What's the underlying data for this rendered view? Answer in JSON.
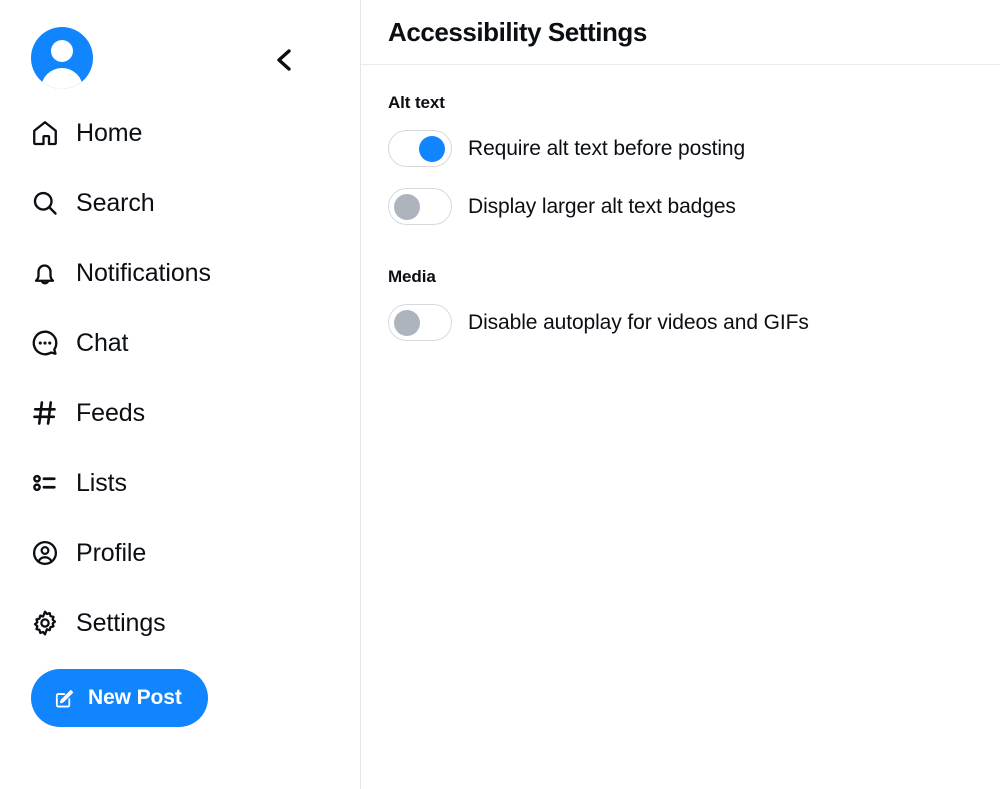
{
  "sidebar": {
    "avatar_name": "user-avatar",
    "collapse_label": "‹",
    "items": [
      {
        "label": "Home",
        "icon": "home-icon"
      },
      {
        "label": "Search",
        "icon": "search-icon"
      },
      {
        "label": "Notifications",
        "icon": "bell-icon"
      },
      {
        "label": "Chat",
        "icon": "chat-bubble-icon"
      },
      {
        "label": "Feeds",
        "icon": "hashtag-icon"
      },
      {
        "label": "Lists",
        "icon": "list-icon"
      },
      {
        "label": "Profile",
        "icon": "person-circle-icon"
      },
      {
        "label": "Settings",
        "icon": "gear-icon"
      }
    ],
    "new_post_label": "New Post",
    "new_post_icon": "compose-icon",
    "accent_color": "#1185fe"
  },
  "main": {
    "title": "Accessibility Settings",
    "sections": [
      {
        "heading": "Alt text",
        "toggles": [
          {
            "label": "Require alt text before posting",
            "state": "on",
            "knob_color": "#1185fe"
          },
          {
            "label": "Display larger alt text badges",
            "state": "off",
            "knob_color": "#aeb4bd"
          }
        ]
      },
      {
        "heading": "Media",
        "toggles": [
          {
            "label": "Disable autoplay for videos and GIFs",
            "state": "off",
            "knob_color": "#aeb4bd"
          }
        ]
      }
    ]
  }
}
